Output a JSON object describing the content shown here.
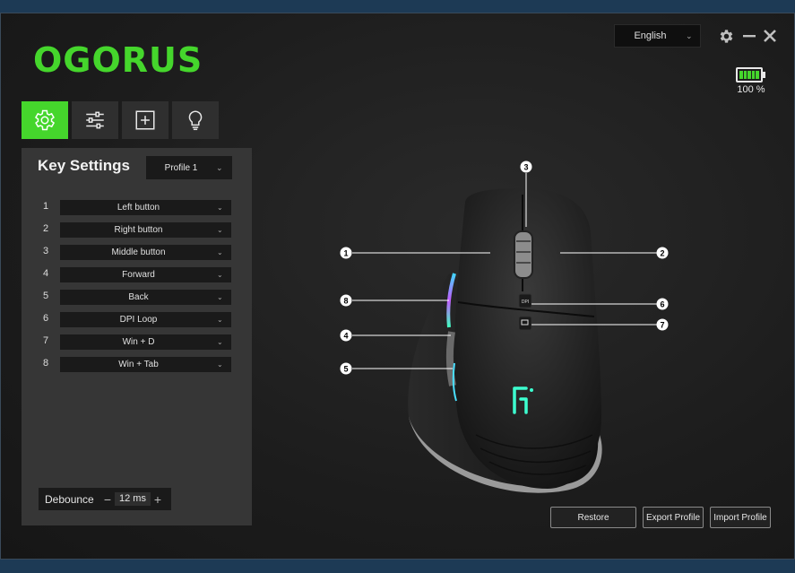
{
  "app": {
    "brand": "OGORUS"
  },
  "language": {
    "selected": "English"
  },
  "battery": {
    "percent_text": "100 %",
    "level": 1.0
  },
  "tabs": [
    {
      "icon": "gear-icon",
      "active": true
    },
    {
      "icon": "sliders-icon",
      "active": false
    },
    {
      "icon": "macro-plus-icon",
      "active": false
    },
    {
      "icon": "lightbulb-icon",
      "active": false
    }
  ],
  "key_settings": {
    "title": "Key Settings",
    "profile": "Profile 1",
    "keys": [
      {
        "num": "1",
        "value": "Left button"
      },
      {
        "num": "2",
        "value": "Right button"
      },
      {
        "num": "3",
        "value": "Middle button"
      },
      {
        "num": "4",
        "value": "Forward"
      },
      {
        "num": "5",
        "value": "Back"
      },
      {
        "num": "6",
        "value": "DPI Loop"
      },
      {
        "num": "7",
        "value": "Win + D"
      },
      {
        "num": "8",
        "value": "Win + Tab"
      }
    ],
    "debounce": {
      "label": "Debounce",
      "value": "12 ms",
      "minus": "−",
      "plus": "+"
    }
  },
  "mouse_callouts": [
    "1",
    "2",
    "3",
    "4",
    "5",
    "6",
    "7",
    "8"
  ],
  "actions": {
    "restore": "Restore",
    "export": "Export Profile",
    "import": "Import Profile"
  },
  "colors": {
    "accent": "#45d62c",
    "panel": "#363636",
    "background": "#1c1c1c"
  }
}
